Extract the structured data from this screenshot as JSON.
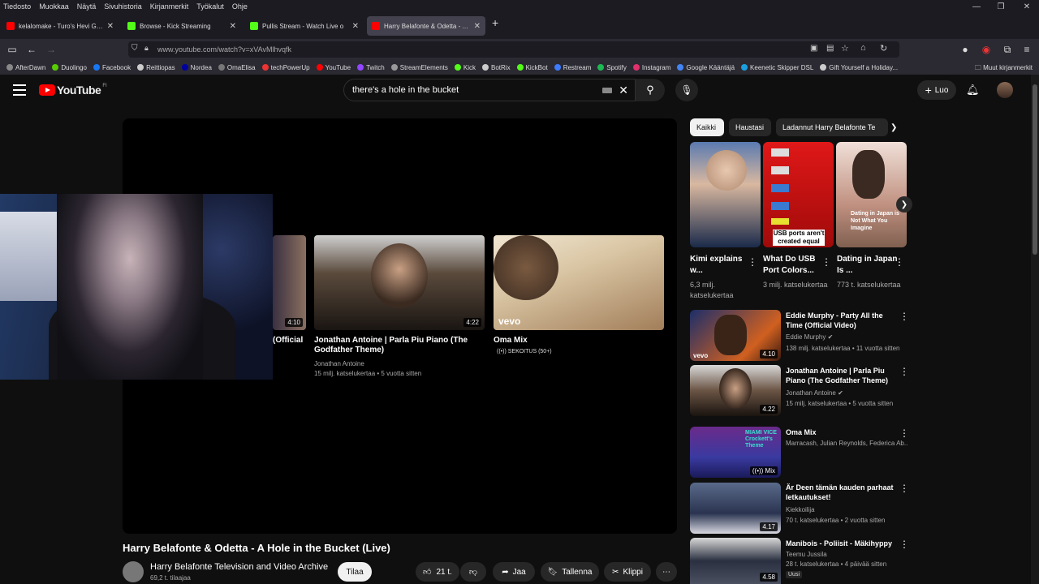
{
  "menubar": [
    "Tiedosto",
    "Muokkaa",
    "Näytä",
    "Sivuhistoria",
    "Kirjanmerkit",
    "Työkalut",
    "Ohje"
  ],
  "tabs": [
    {
      "title": "kelalomake - Turo's Hevi Gee -",
      "color": "#ff0000"
    },
    {
      "title": "Browse - Kick Streaming",
      "color": "#53fc18"
    },
    {
      "title": "Pullis Stream - Watch Live o",
      "color": "#53fc18"
    },
    {
      "title": "Harry Belafonte & Odetta - A H",
      "color": "#ff0000"
    }
  ],
  "url": "www.youtube.com/watch?v=xVAvMlhvqfk",
  "bookmarks": [
    {
      "label": "AfterDawn",
      "color": "#888"
    },
    {
      "label": "Duolingo",
      "color": "#58cc02"
    },
    {
      "label": "Facebook",
      "color": "#1877f2"
    },
    {
      "label": "Reittiopas",
      "color": "#ccc"
    },
    {
      "label": "Nordea",
      "color": "#0000a0"
    },
    {
      "label": "OmaElisa",
      "color": "#777"
    },
    {
      "label": "techPowerUp",
      "color": "#e33"
    },
    {
      "label": "YouTube",
      "color": "#ff0000"
    },
    {
      "label": "Twitch",
      "color": "#9146ff"
    },
    {
      "label": "StreamElements",
      "color": "#999"
    },
    {
      "label": "Kick",
      "color": "#53fc18"
    },
    {
      "label": "BotRix",
      "color": "#ccc"
    },
    {
      "label": "KickBot",
      "color": "#53fc18"
    },
    {
      "label": "Restream",
      "color": "#3d7bff"
    },
    {
      "label": "Spotify",
      "color": "#1db954"
    },
    {
      "label": "Instagram",
      "color": "#e1306c"
    },
    {
      "label": "Google Kääntäjä",
      "color": "#4285f4"
    },
    {
      "label": "Keenetic Skipper DSL",
      "color": "#1aa0e0"
    },
    {
      "label": "Gift Yourself a Holiday...",
      "color": "#ccc"
    }
  ],
  "other_bookmarks": "Muut kirjanmerkit",
  "yt": {
    "logo": "YouTube",
    "region": "FI",
    "search": "there's a hole in the bucket",
    "create": "Luo"
  },
  "endcards": [
    {
      "title": "(Official",
      "duration": "4:10"
    },
    {
      "title": "Jonathan Antoine | Parla Piu Piano (The Godfather Theme)",
      "duration": "4:22",
      "channel": "Jonathan Antoine",
      "meta": "15 milj. katselukertaa • 5 vuotta sitten"
    },
    {
      "title": "Oma Mix",
      "badge": "vevo",
      "sub": "SEKOITUS (50+)"
    }
  ],
  "video": {
    "title": "Harry Belafonte & Odetta - A Hole in the Bucket (Live)",
    "channel": "Harry Belafonte Television and Video Archive",
    "subs": "69,2 t. tilaajaa",
    "subscribe": "Tilaa",
    "likes": "21 t.",
    "share": "Jaa",
    "save": "Tallenna",
    "clip": "Klippi"
  },
  "chips": [
    "Kaikki",
    "Haustasi",
    "Ladannut Harry Belafonte Te"
  ],
  "shorts": [
    {
      "title": "Kimi explains w...",
      "meta": "6,3 milj. katselukertaa"
    },
    {
      "title": "What Do USB Port Colors...",
      "meta": "3 milj. katselukertaa",
      "overlay": "USB ports aren't created equal"
    },
    {
      "title": "Dating in Japan Is ...",
      "meta": "773 t. katselukertaa",
      "overlay": "Dating in Japan is Not What You Imagine"
    }
  ],
  "related": [
    {
      "title": "Eddie Murphy - Party All the Time (Official Video)",
      "channel": "Eddie Murphy",
      "meta": "138 milj. katselukertaa • 11 vuotta sitten",
      "duration": "4.10",
      "badge": "vevo"
    },
    {
      "title": "Jonathan Antoine | Parla Piu Piano (The Godfather Theme)",
      "channel": "Jonathan Antoine",
      "meta": "15 milj. katselukertaa • 5 vuotta sitten",
      "duration": "4.22"
    },
    {
      "title": "Oma Mix",
      "channel": "Marracash, Julian Reynolds, Federica Ab...",
      "meta": "",
      "duration": "Mix",
      "overlay": "MIAMI VICE Crockett's Theme"
    },
    {
      "title": "Är Deen tämän kauden parhaat letkautukset!",
      "channel": "Kiekkoilija",
      "meta": "70 t. katselukertaa • 2 vuotta sitten",
      "duration": "4.17"
    },
    {
      "title": "Manibois - Poliisit - Mäkihyppy",
      "channel": "Teemu Jussila",
      "meta": "28 t. katselukertaa • 4 päivää sitten",
      "duration": "4.58",
      "badge": "Uusi"
    }
  ],
  "colors": {
    "bg": "#0f0f0f",
    "accent": "#ff0000",
    "chip_active": "#f1f1f1"
  }
}
